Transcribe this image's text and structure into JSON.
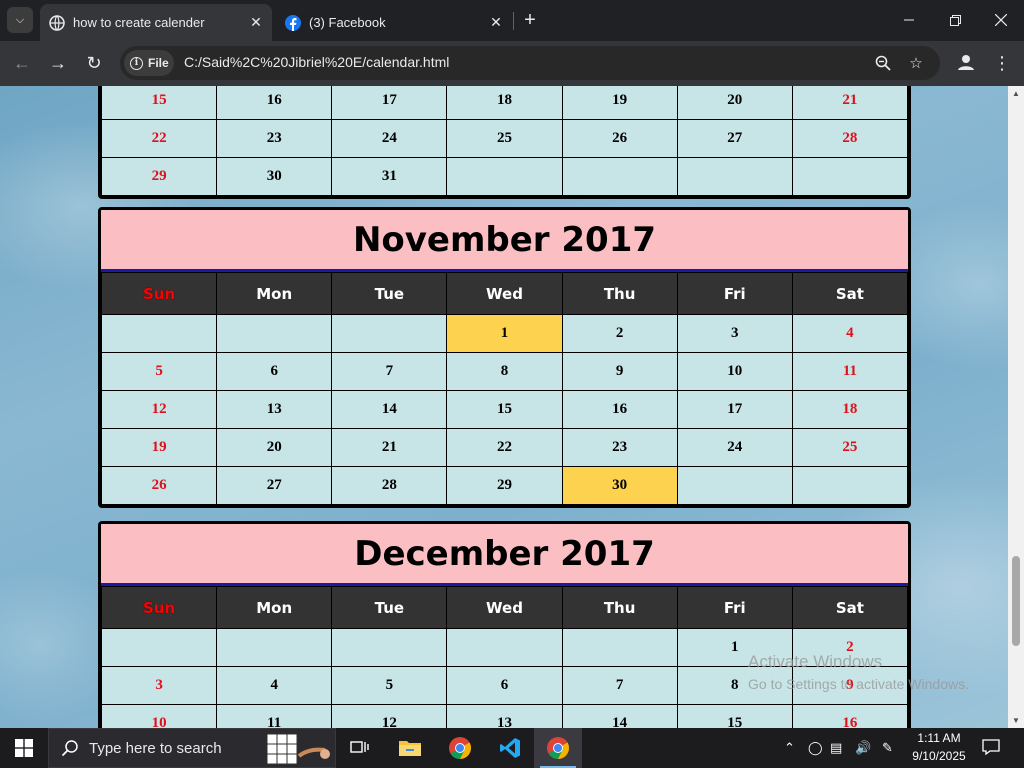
{
  "browser": {
    "tabs": [
      {
        "title": "how to create calender",
        "active": true,
        "icon": "globe-icon"
      },
      {
        "title": "(3) Facebook",
        "active": false,
        "icon": "facebook-icon"
      }
    ],
    "omnibox": {
      "scheme_label": "File",
      "url": "C:/Said%2C%20Jibriel%20E/calendar.html"
    }
  },
  "page": {
    "accent_colors": {
      "title_bg": "#fbbfc3",
      "header_bg": "#333333",
      "cell_bg": "#c7e4e7",
      "highlight": "#fdd24e",
      "weekend_red": "#e0101a"
    },
    "weekdays": [
      "Sun",
      "Mon",
      "Tue",
      "Wed",
      "Thu",
      "Fri",
      "Sat"
    ],
    "october_partial": {
      "rows": [
        [
          "15",
          "16",
          "17",
          "18",
          "19",
          "20",
          "21"
        ],
        [
          "22",
          "23",
          "24",
          "25",
          "26",
          "27",
          "28"
        ],
        [
          "29",
          "30",
          "31",
          "",
          "",
          "",
          ""
        ]
      ]
    },
    "november": {
      "title": "November 2017",
      "highlighted": [
        "1",
        "30"
      ],
      "rows": [
        [
          "",
          "",
          "",
          "1",
          "2",
          "3",
          "4"
        ],
        [
          "5",
          "6",
          "7",
          "8",
          "9",
          "10",
          "11"
        ],
        [
          "12",
          "13",
          "14",
          "15",
          "16",
          "17",
          "18"
        ],
        [
          "19",
          "20",
          "21",
          "22",
          "23",
          "24",
          "25"
        ],
        [
          "26",
          "27",
          "28",
          "29",
          "30",
          "",
          ""
        ]
      ]
    },
    "december": {
      "title": "December 2017",
      "rows": [
        [
          "",
          "",
          "",
          "",
          "",
          "1",
          "2"
        ],
        [
          "3",
          "4",
          "5",
          "6",
          "7",
          "8",
          "9"
        ],
        [
          "10",
          "11",
          "12",
          "13",
          "14",
          "15",
          "16"
        ]
      ]
    },
    "watermark": {
      "line1": "Activate Windows",
      "line2": "Go to Settings to activate Windows."
    }
  },
  "taskbar": {
    "search_placeholder": "Type here to search",
    "time": "1:11 AM",
    "date": "9/10/2025"
  }
}
